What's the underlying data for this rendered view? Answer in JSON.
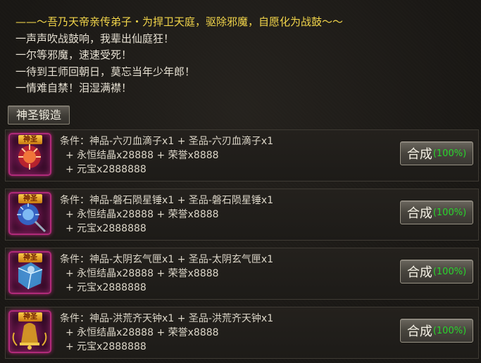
{
  "intro": {
    "title": "——〜吾乃天帝亲传弟子・为捍卫天庭，驱除邪魔，自愿化为战鼓〜〜",
    "lines": [
      "一声声吹战鼓响，我辈出仙庭狂！",
      "一尔等邪魔，速速受死！",
      "一待到王师回朝日，莫忘当年少年郎！",
      "一情难自禁！泪湿满襟！"
    ]
  },
  "tab": {
    "label": "神圣锻造"
  },
  "colors": {
    "title": "#f2d54a",
    "percent": "#29d52c",
    "icon_glow": "#b02a7a"
  },
  "recipes": [
    {
      "badge": "神圣",
      "icon": "blood-droplet-weapon-icon",
      "line1": "条件：神品-六刃血滴子x1 + 圣品-六刃血滴子x1",
      "line2": "+ 永恒结晶x28888 + 荣誉x8888",
      "line3": "+ 元宝x2888888",
      "button": "合成",
      "rate": "(100%)"
    },
    {
      "badge": "神圣",
      "icon": "meteor-hammer-icon",
      "line1": "条件：神品-磐石陨星锤x1 + 圣品-磐石陨星锤x1",
      "line2": "+ 永恒结晶x28888 + 荣誉x8888",
      "line3": "+ 元宝x2888888",
      "button": "合成",
      "rate": "(100%)"
    },
    {
      "badge": "神圣",
      "icon": "lunar-box-icon",
      "line1": "条件：神品-太阴玄气匣x1 + 圣品-太阴玄气匣x1",
      "line2": "+ 永恒结晶x28888 + 荣誉x8888",
      "line3": "+ 元宝x2888888",
      "button": "合成",
      "rate": "(100%)"
    },
    {
      "badge": "神圣",
      "icon": "bell-icon",
      "line1": "条件：神品-洪荒齐天钟x1 + 圣品-洪荒齐天钟x1",
      "line2": "+ 永恒结晶x28888 + 荣誉x8888",
      "line3": "+ 元宝x2888888",
      "button": "合成",
      "rate": "(100%)"
    }
  ]
}
